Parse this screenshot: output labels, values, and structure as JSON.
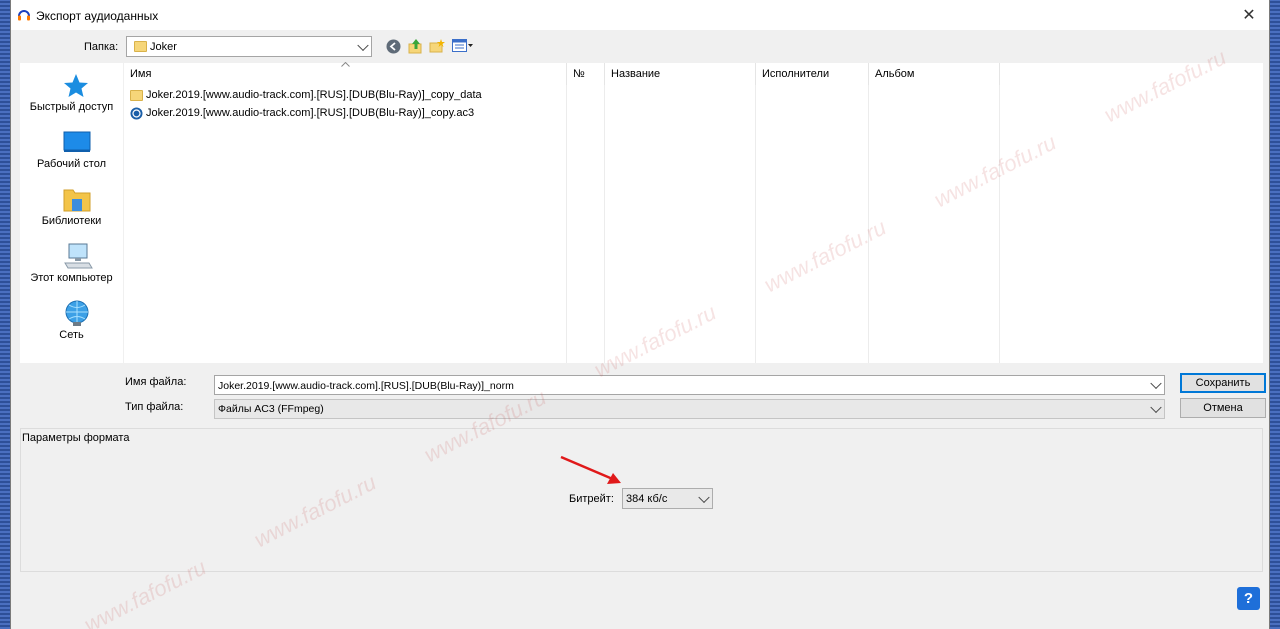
{
  "window": {
    "title": "Экспорт аудиоданных",
    "close_glyph": "✕"
  },
  "toolbar": {
    "folder_label": "Папка:",
    "folder_value": "Joker"
  },
  "places": [
    {
      "label": "Быстрый доступ",
      "icon": "star-icon"
    },
    {
      "label": "Рабочий стол",
      "icon": "desktop-icon"
    },
    {
      "label": "Библиотеки",
      "icon": "libraries-icon"
    },
    {
      "label": "Этот компьютер",
      "icon": "computer-icon"
    },
    {
      "label": "Сеть",
      "icon": "network-icon"
    }
  ],
  "columns": [
    "Имя",
    "№",
    "Название",
    "Исполнители",
    "Альбом"
  ],
  "files": [
    {
      "name": "Joker.2019.[www.audio-track.com].[RUS].[DUB(Blu-Ray)]_copy_data",
      "icon": "folder-icon"
    },
    {
      "name": "Joker.2019.[www.audio-track.com].[RUS].[DUB(Blu-Ray)]_copy.ac3",
      "icon": "audio-file-icon"
    }
  ],
  "filename": {
    "label": "Имя файла:",
    "value": "Joker.2019.[www.audio-track.com].[RUS].[DUB(Blu-Ray)]_norm"
  },
  "filetype": {
    "label": "Тип файла:",
    "value": "Файлы AC3 (FFmpeg)"
  },
  "buttons": {
    "save": "Сохранить",
    "cancel": "Отмена"
  },
  "format_options": {
    "title": "Параметры формата",
    "bitrate_label": "Битрейт:",
    "bitrate_value": "384 кб/с"
  },
  "help": "?",
  "watermark": "www.fafofu.ru",
  "colors": {
    "accent": "#0078d7",
    "arrow": "#e0191a"
  }
}
